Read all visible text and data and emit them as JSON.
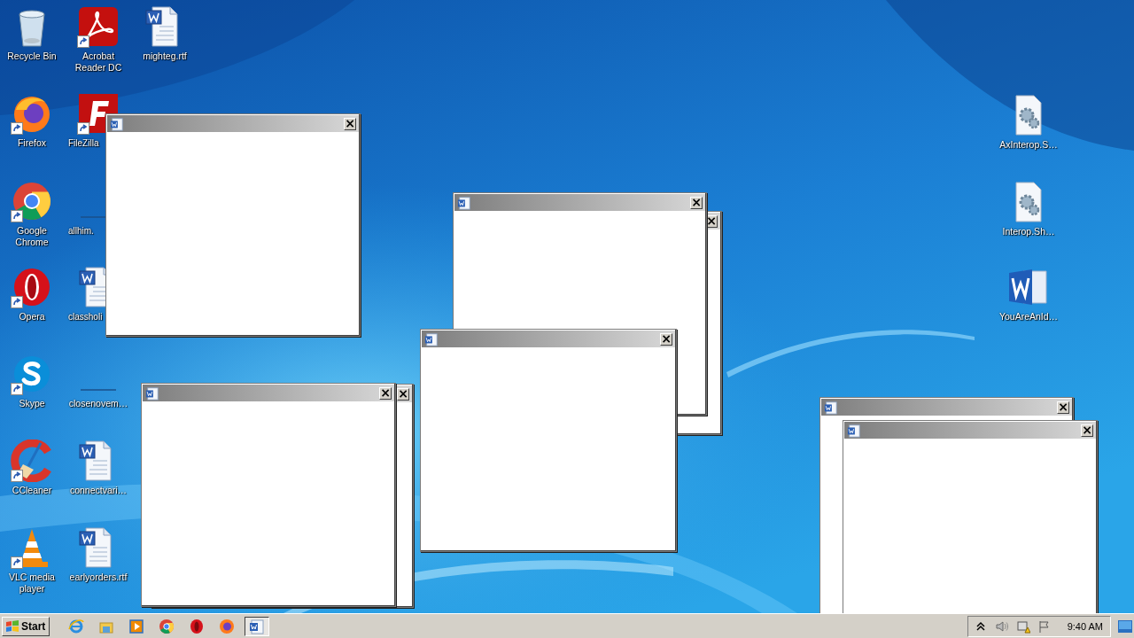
{
  "desktop_icons": [
    {
      "label": "Recycle Bin",
      "kind": "recycle",
      "shortcut": false
    },
    {
      "label": "Firefox",
      "kind": "firefox",
      "shortcut": true
    },
    {
      "label": "Google Chrome",
      "kind": "chrome",
      "shortcut": true
    },
    {
      "label": "Opera",
      "kind": "opera",
      "shortcut": true
    },
    {
      "label": "Skype",
      "kind": "skype",
      "shortcut": true
    },
    {
      "label": "CCleaner",
      "kind": "ccleaner",
      "shortcut": true
    },
    {
      "label": "VLC media player",
      "kind": "vlc",
      "shortcut": true
    },
    {
      "label": "Acrobat Reader DC",
      "kind": "pdf",
      "shortcut": true
    },
    {
      "label": "FileZilla",
      "kind": "filezilla",
      "shortcut": true
    },
    {
      "label": "allhim.",
      "kind": "blank",
      "shortcut": false
    },
    {
      "label": "classholi",
      "kind": "word-doc",
      "shortcut": false
    },
    {
      "label": "closenovem…",
      "kind": "blank",
      "shortcut": false
    },
    {
      "label": "connectvari…",
      "kind": "word-doc",
      "shortcut": false
    },
    {
      "label": "earlyorders.rtf",
      "kind": "word-doc",
      "shortcut": false
    },
    {
      "label": "mighteg.rtf",
      "kind": "word-doc",
      "shortcut": false
    },
    {
      "label": "AxInterop.S…",
      "kind": "gear-doc",
      "shortcut": false
    },
    {
      "label": "Interop.Sh…",
      "kind": "gear-doc",
      "shortcut": false
    },
    {
      "label": "YouAreAnId…",
      "kind": "word-app",
      "shortcut": false
    }
  ],
  "windows": [
    {
      "kind": "dialog",
      "close": "×"
    },
    {
      "kind": "dialog",
      "close": "×"
    },
    {
      "kind": "dialog",
      "close": "×"
    },
    {
      "kind": "dialog",
      "close": "×"
    },
    {
      "kind": "dialog",
      "close": "×"
    },
    {
      "kind": "dialog",
      "close": "×"
    },
    {
      "kind": "dialog",
      "close": "×"
    },
    {
      "kind": "dialog",
      "close": "×"
    }
  ],
  "taskbar": {
    "start": "Start",
    "buttons": [
      {
        "kind": "ie",
        "selected": false
      },
      {
        "kind": "explorer",
        "selected": false
      },
      {
        "kind": "media",
        "selected": false
      },
      {
        "kind": "chrome",
        "selected": false
      },
      {
        "kind": "opera",
        "selected": false
      },
      {
        "kind": "firefox",
        "selected": false
      },
      {
        "kind": "word",
        "selected": true
      }
    ],
    "clock": "9:40 AM"
  }
}
